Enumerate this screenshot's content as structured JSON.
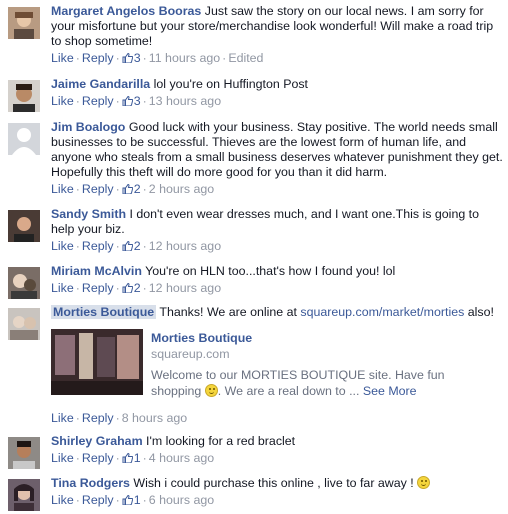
{
  "common": {
    "like_label": "Like",
    "reply_label": "Reply",
    "sep": "·"
  },
  "comments": [
    {
      "author": "Margaret Angelos Booras",
      "text": "Just saw the story on our local news. I am sorry for your misfortune but your store/merchandise look wonderful! Will make a road trip to shop sometime!",
      "likes": "3",
      "time": "11 hours ago",
      "edited": "Edited"
    },
    {
      "author": "Jaime Gandarilla",
      "text": "lol you're on Huffington Post",
      "likes": "3",
      "time": "13 hours ago"
    },
    {
      "author": "Jim Boalogo",
      "text": "Good luck with your business. Stay positive. The world needs small businesses to be successful. Thieves are the lowest form of human life, and anyone who steals from a small business deserves whatever punishment they get. Hopefully this theft will do more good for you than it did harm.",
      "likes": "2",
      "time": "2 hours ago"
    },
    {
      "author": "Sandy Smith",
      "text": "I don't even wear dresses much, and I want one.This is going to help your biz.",
      "likes": "2",
      "time": "12 hours ago"
    },
    {
      "author": "Miriam McAlvin",
      "text": "You're on HLN too...that's how I found you! lol",
      "likes": "2",
      "time": "12 hours ago"
    },
    {
      "author": "Morties Boutique",
      "text": "Thanks! We are online at ",
      "link": "squareup.com/market/morties",
      "text_after": " also!",
      "time": "8 hours ago",
      "preview": {
        "title": "Morties Boutique",
        "domain": "squareup.com",
        "desc_1": "Welcome to our MORTIES BOUTIQUE site. Have fun shopping",
        "desc_2": ". We are a real down to ...",
        "see_more": "See More"
      }
    },
    {
      "author": "Shirley Graham",
      "text": "I'm looking for a red braclet",
      "likes": "1",
      "time": "4 hours ago"
    },
    {
      "author": "Tina Rodgers",
      "text": "Wish i could purchase this online , live to far away ! ",
      "likes": "1",
      "time": "6 hours ago"
    }
  ]
}
